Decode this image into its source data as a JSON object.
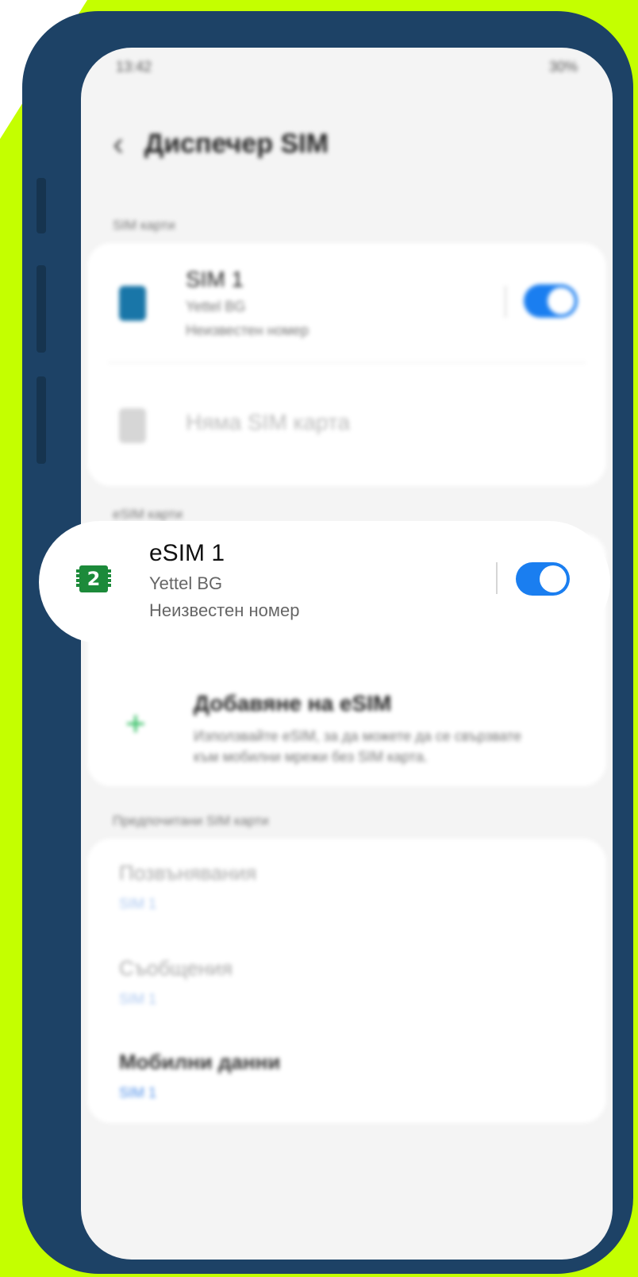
{
  "status_bar": {
    "time": "13:42",
    "battery": "30%"
  },
  "header": {
    "back_icon": "chevron-left-icon",
    "title": "Диспечер SIM"
  },
  "sim_section": {
    "label": "SIM карти",
    "sim1": {
      "title": "SIM 1",
      "carrier": "Yettel BG",
      "number": "Неизвестен номер",
      "enabled": true
    },
    "no_sim_label": "Няма SIM карта"
  },
  "esim_section": {
    "label": "eSIM карти",
    "esim1": {
      "badge": "2",
      "title": "eSIM 1",
      "carrier": "Yettel BG",
      "number": "Неизвестен номер",
      "enabled": true
    },
    "add": {
      "title": "Добавяне на eSIM",
      "description": "Използвайте eSIM, за да можете да се свързвате към мобилни мрежи без SIM карта."
    }
  },
  "preferred_section": {
    "label": "Предпочитани SIM карти",
    "calls": {
      "title": "Позвънявания",
      "value": "SIM 1"
    },
    "messages": {
      "title": "Съобщения",
      "value": "SIM 1"
    },
    "mobile_data": {
      "title": "Мобилни данни",
      "value": "SIM 1"
    }
  },
  "colors": {
    "brand_green": "#c4ff00",
    "toggle_on": "#1a7ef0",
    "phone_frame": "#1d4266"
  }
}
